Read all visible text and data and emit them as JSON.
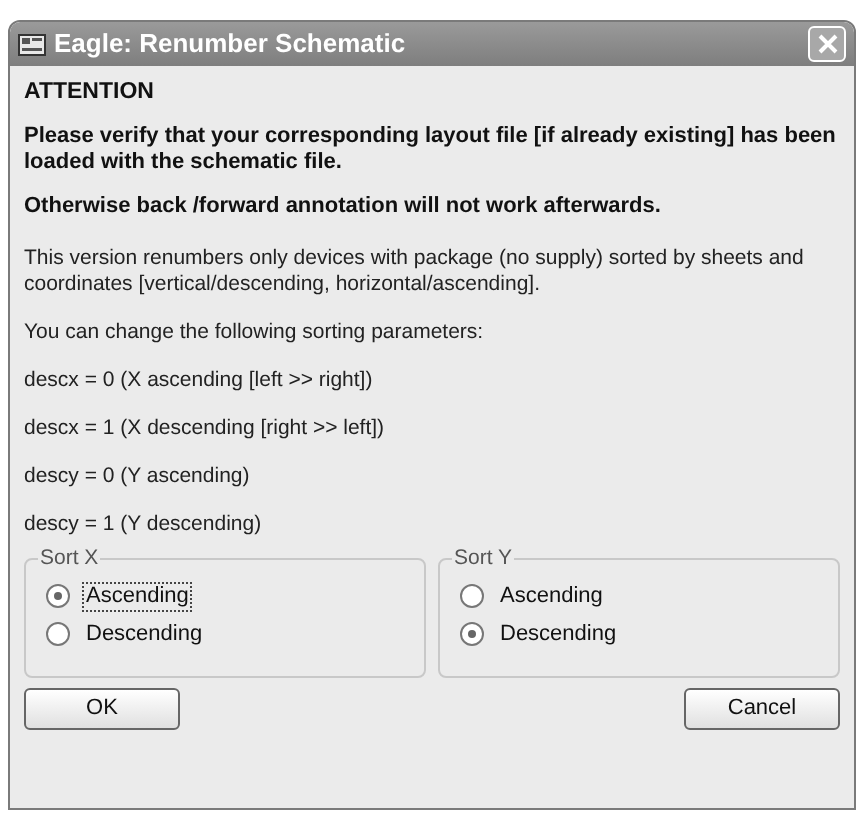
{
  "window": {
    "title": "Eagle: Renumber Schematic"
  },
  "heading": "ATTENTION",
  "warnings": [
    "Please verify that your corresponding layout file [if already existing] has been loaded with the schematic file.",
    "Otherwise back /forward annotation will not work afterwards."
  ],
  "paragraphs": [
    "This version renumbers only devices with package (no supply) sorted by sheets and coordinates [vertical/descending, horizontal/ascending].",
    "You can change the following sorting parameters:",
    "descx = 0 (X ascending [left >> right])",
    "descx = 1 (X descending [right >> left])",
    "descy = 0 (Y ascending)",
    "descy = 1 (Y descending)"
  ],
  "groups": [
    {
      "title": "Sort X",
      "options": [
        {
          "label": "Ascending",
          "selected": true,
          "focused": true
        },
        {
          "label": "Descending",
          "selected": false,
          "focused": false
        }
      ]
    },
    {
      "title": "Sort Y",
      "options": [
        {
          "label": "Ascending",
          "selected": false,
          "focused": false
        },
        {
          "label": "Descending",
          "selected": true,
          "focused": false
        }
      ]
    }
  ],
  "buttons": [
    "OK",
    "Cancel"
  ]
}
